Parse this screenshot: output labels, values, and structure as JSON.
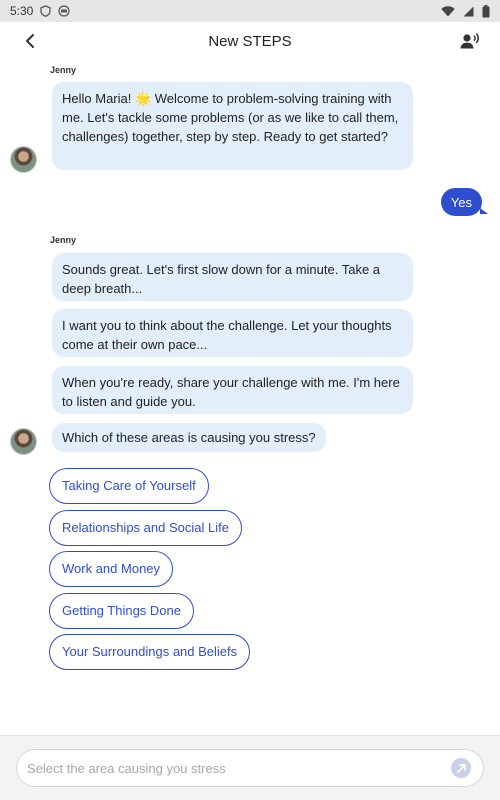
{
  "status_bar": {
    "time": "5:30"
  },
  "header": {
    "title": "New STEPS"
  },
  "chat": {
    "block1": {
      "sender": "Jenny",
      "message": "Hello Maria! 🌟 Welcome to problem-solving training with me.  Let's tackle some problems (or as we like to call them, challenges) together, step by step.  Ready to get started?"
    },
    "user_reply": "Yes",
    "block2": {
      "sender": "Jenny",
      "messages": [
        "Sounds great.  Let's first slow down for a minute.  Take a deep breath...",
        "I want you to think about the challenge. Let your thoughts come at their own pace...",
        "When you're ready, share your challenge with me.  I'm here to listen and guide you.",
        "Which of these areas is causing you stress?"
      ]
    },
    "options": [
      "Taking Care of Yourself",
      "Relationships and Social Life",
      "Work and Money",
      "Getting Things Done",
      "Your Surroundings and Beliefs"
    ]
  },
  "input": {
    "placeholder": "Select the area causing you stress"
  },
  "colors": {
    "accent": "#2f4ecf",
    "bubble": "#e3eefb"
  }
}
